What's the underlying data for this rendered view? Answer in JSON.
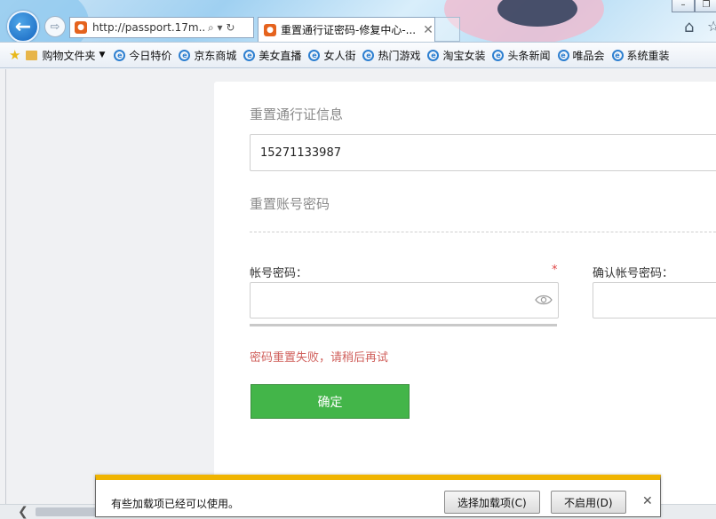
{
  "browser": {
    "address": "http://passport.17m...",
    "address_controls": "⌕ ▾ ↻",
    "tab_title": "重置通行证密码-修复中心-...",
    "tab_close": "✕",
    "back_glyph": "←",
    "forward_glyph": "⇨",
    "home_glyph": "⌂",
    "favorites_glyph": "☆",
    "window_buttons": [
      "–",
      "❐"
    ]
  },
  "favorites": {
    "folder_label": "购物文件夹",
    "items": [
      "今日特价",
      "京东商城",
      "美女直播",
      "女人街",
      "热门游戏",
      "淘宝女装",
      "头条新闻",
      "唯品会",
      "系统重装"
    ]
  },
  "form": {
    "section_info_title": "重置通行证信息",
    "phone_value": "15271133987",
    "section_pwd_title": "重置账号密码",
    "password_label": "帐号密码：",
    "required_mark": "*",
    "confirm_password_label": "确认帐号密码：",
    "error_message": "密码重置失败，请稍后再试",
    "confirm_button": "确定"
  },
  "notification": {
    "message": "有些加载项已经可以使用。",
    "choose_addons_button": "选择加载项(C)",
    "disable_button": "不启用(D)",
    "close": "✕"
  },
  "colors": {
    "confirm_button_bg": "#43b549",
    "error_text": "#d0605c",
    "notification_accent": "#f0b400"
  }
}
